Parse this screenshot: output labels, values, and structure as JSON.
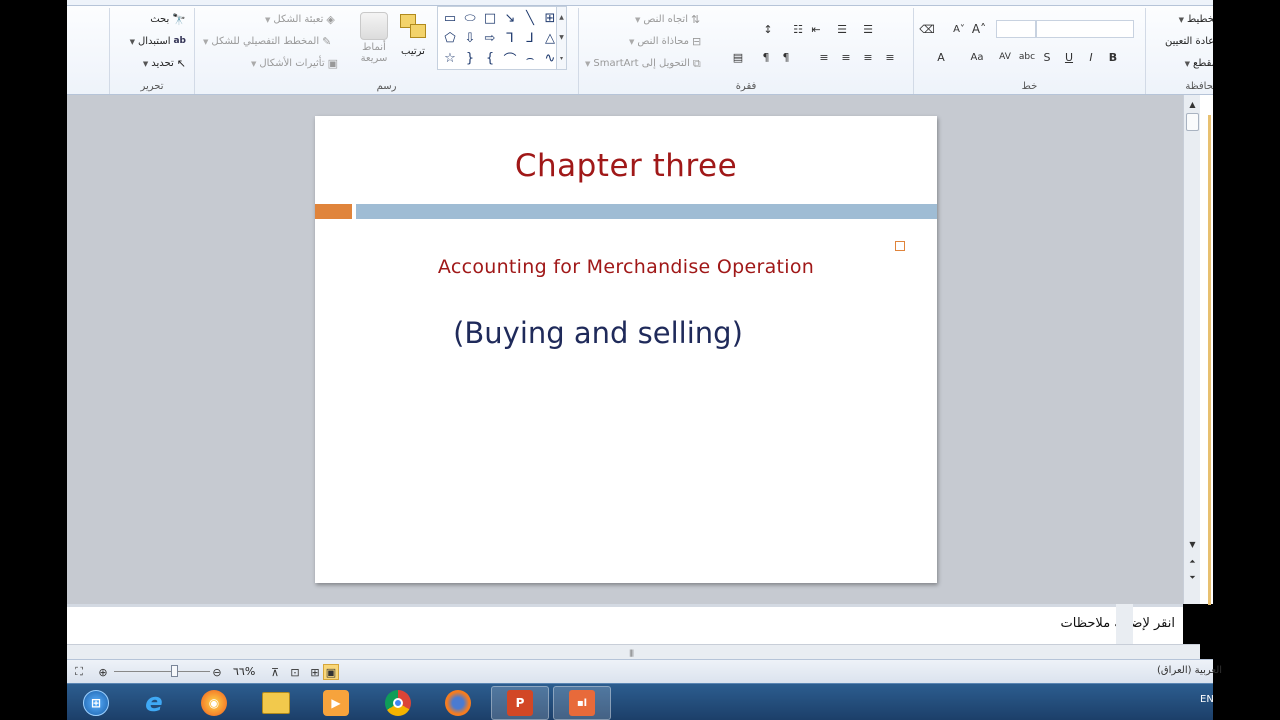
{
  "ribbon": {
    "groups": [
      {
        "id": "editing",
        "label": "تحرير"
      },
      {
        "id": "drawing",
        "label": "رسم"
      },
      {
        "id": "paragraph",
        "label": "فقرة"
      },
      {
        "id": "font",
        "label": "خط"
      },
      {
        "id": "clipboard",
        "label": "الحافظة"
      }
    ],
    "editing": {
      "find": "بحث",
      "replace": "استبدال",
      "select": "تحديد"
    },
    "drawing": {
      "shape_fill": "تعبئة الشكل",
      "shape_outline": "المخطط التفصيلي للشكل",
      "shape_effects": "تأثيرات الأشكال",
      "quick_styles_line1": "أنماط",
      "quick_styles_line2": "سريعة",
      "arrange": "ترتيب"
    },
    "paragraph": {
      "text_direction": "اتجاه النص",
      "align_text": "محاذاة النص",
      "convert_smartart": "التحويل إلى SmartArt"
    },
    "font": {
      "font_name": "",
      "font_size": ""
    },
    "clipboard": {
      "layout": "تخطيط",
      "reset": "إعادة التعيين",
      "section": "مقطع"
    }
  },
  "slide": {
    "title": "Chapter three",
    "subtitle": "Accounting for Merchandise Operation",
    "body": "(Buying and selling)"
  },
  "notes": {
    "placeholder": "انقر لإضافة ملاحظات"
  },
  "status": {
    "zoom": "٦٦%",
    "language": "العربية (العراق)"
  },
  "taskbar": {
    "items": [
      "start",
      "internet-explorer",
      "chromium-browser",
      "file-explorer",
      "media-player",
      "chrome",
      "firefox",
      "powerpoint",
      "powerpoint-slideshow"
    ],
    "lang": "EN"
  },
  "colors": {
    "title_red": "#a01818",
    "body_navy": "#1f2a5a",
    "accent_orange": "#e0843b",
    "accent_blue": "#9fbcd4"
  }
}
